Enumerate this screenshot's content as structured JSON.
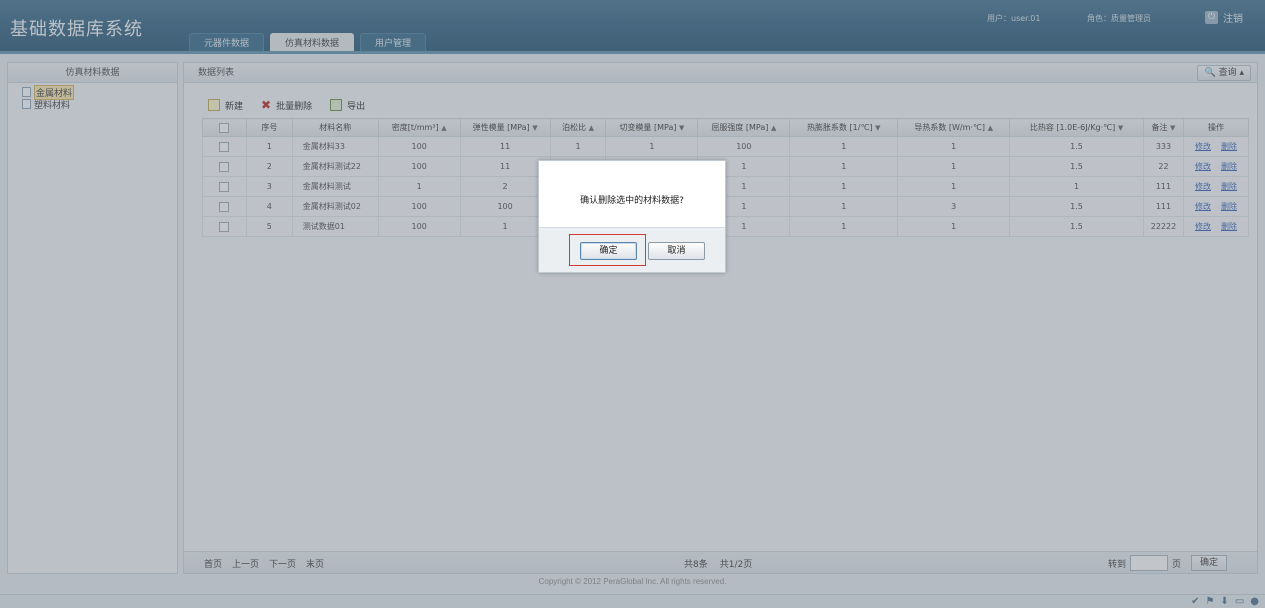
{
  "header": {
    "app_title": "基础数据库系统",
    "tabs": [
      "元器件数据",
      "仿真材料数据",
      "用户管理"
    ],
    "user_label": "用户：user.01",
    "role_label": "角色：质量管理员",
    "logout_label": "注销"
  },
  "left_panel": {
    "title": "仿真材料数据",
    "tree": [
      "金属材料",
      "塑料材料"
    ]
  },
  "right_panel": {
    "title": "数据列表",
    "query_label": "查询",
    "toolbar": {
      "new": "新建",
      "batch_delete": "批量删除",
      "export": "导出"
    },
    "columns": [
      "序号",
      "材料名称",
      "密度[t/mm³]",
      "弹性模量 [MPa]",
      "泊松比",
      "切变模量 [MPa]",
      "屈服强度 [MPa]",
      "热膨胀系数 [1/℃]",
      "导热系数 [W/m·℃]",
      "比热容 [1.0E-6J/Kg·℃]",
      "备注",
      "操作"
    ],
    "rows": [
      [
        "1",
        "金属材料33",
        "100",
        "11",
        "1",
        "1",
        "100",
        "1",
        "1",
        "1.5",
        "333"
      ],
      [
        "2",
        "金属材料测试22",
        "100",
        "11",
        "",
        "",
        "1",
        "1",
        "1",
        "1.5",
        "22"
      ],
      [
        "3",
        "金属材料测试",
        "1",
        "2",
        "",
        "",
        "1",
        "1",
        "1",
        "1",
        "111"
      ],
      [
        "4",
        "金属材料测试02",
        "100",
        "100",
        "",
        "",
        "1",
        "1",
        "3",
        "1.5",
        "111"
      ],
      [
        "5",
        "测试数据01",
        "100",
        "1",
        "",
        "",
        "1",
        "1",
        "1",
        "1.5",
        "22222"
      ]
    ],
    "row_actions": {
      "edit": "修改",
      "delete": "删除"
    },
    "pager": {
      "first": "首页",
      "prev": "上一页",
      "next": "下一页",
      "last": "末页",
      "total": "共8条",
      "pages": "共1/2页",
      "goto": "转到",
      "page_unit": "页",
      "confirm": "确定"
    }
  },
  "footer": "Copyright © 2012 PeraGlobal Inc. All rights reserved.",
  "dialog": {
    "message": "确认删除选中的材料数据?",
    "ok": "确定",
    "cancel": "取消"
  }
}
